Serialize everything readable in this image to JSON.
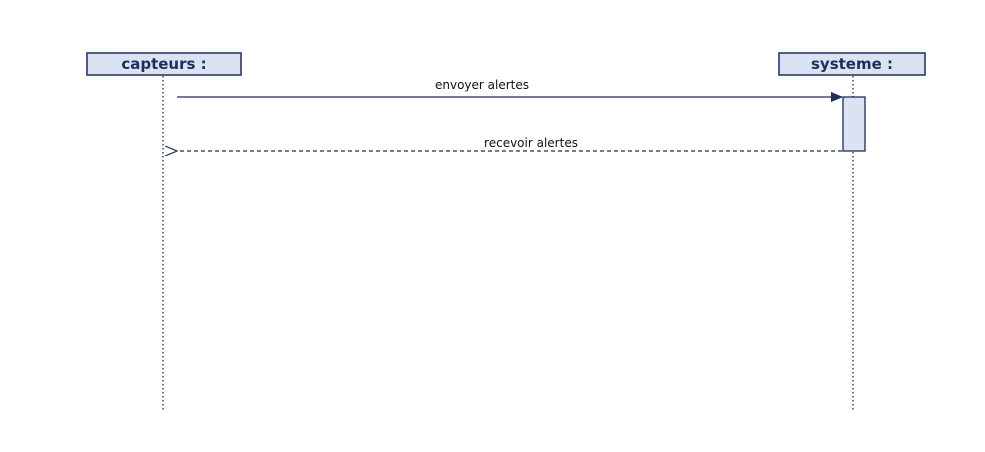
{
  "participants": [
    {
      "id": "capteurs",
      "label": "capteurs :"
    },
    {
      "id": "systeme",
      "label": "systeme :"
    }
  ],
  "messages": [
    {
      "label": "envoyer alertes",
      "from": "capteurs",
      "to": "systeme",
      "kind": "synchronous"
    },
    {
      "label": "recevoir alertes",
      "from": "systeme",
      "to": "capteurs",
      "kind": "return"
    }
  ],
  "colors": {
    "line": "#1f2d5a",
    "box_fill": "#dbe3f3",
    "text": "#111111"
  }
}
